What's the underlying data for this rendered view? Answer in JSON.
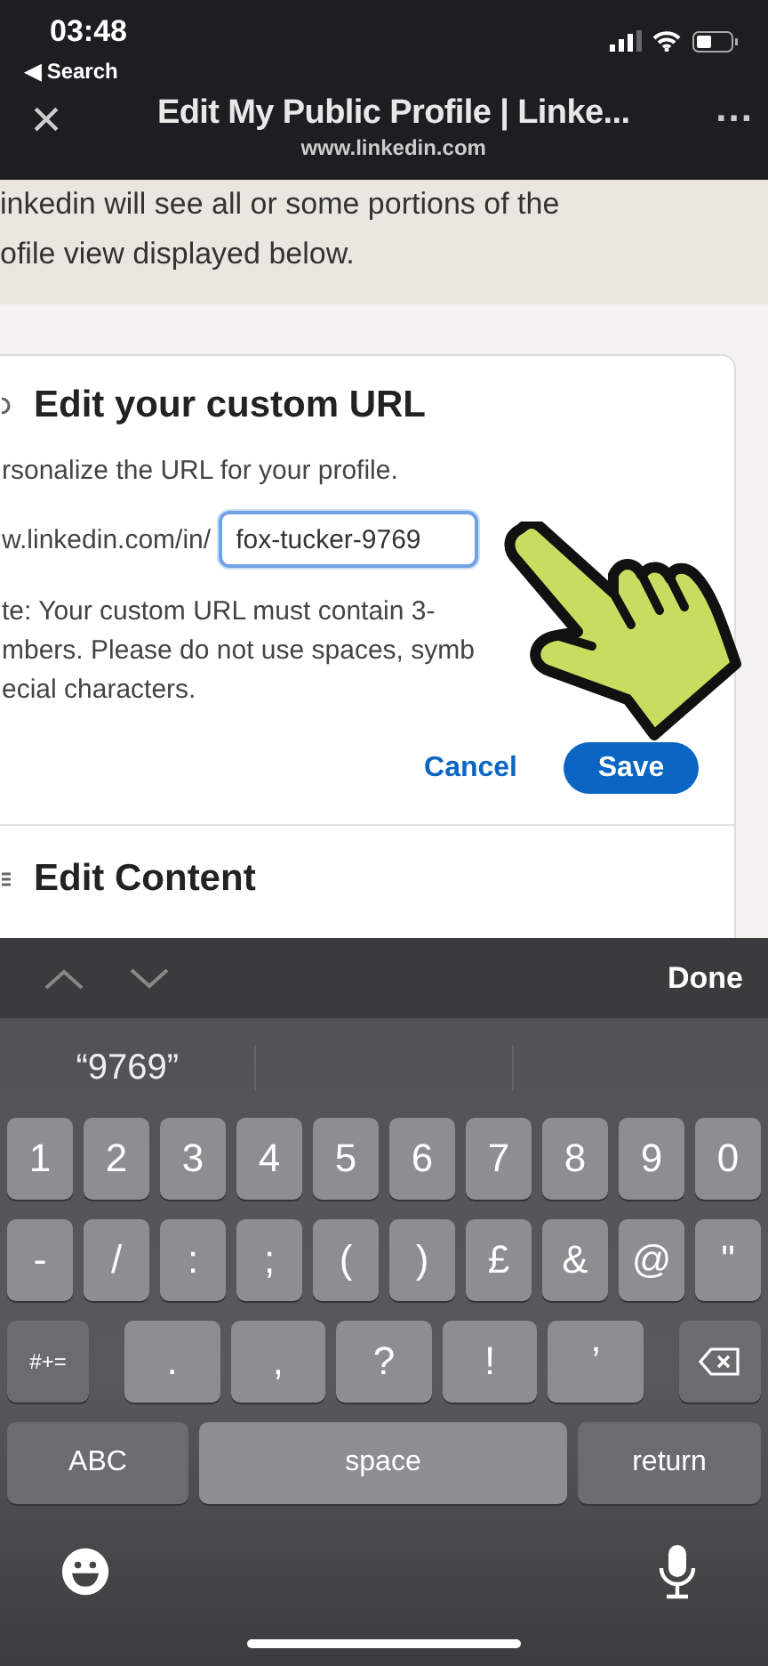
{
  "status_bar": {
    "time": "03:48",
    "back_label": "◀ Search"
  },
  "nav_bar": {
    "close": "×",
    "title": "Edit My Public Profile | Linke...",
    "subtitle": "www.linkedin.com",
    "more": "..."
  },
  "intro_lines": [
    "inkedin will see all or some portions of the",
    "ofile view displayed below."
  ],
  "card": {
    "title": "Edit your custom URL",
    "subtitle": "rsonalize the URL for your profile.",
    "url_prefix": "w.linkedin.com/in/",
    "url_field": {
      "value": "fox-tucker-9769",
      "focused": true
    },
    "note": [
      "te: Your custom URL must contain 3-",
      "mbers. Please do not use spaces, symb",
      "ecial characters."
    ],
    "cancel": "Cancel",
    "save": "Save",
    "next_section": "Edit Content"
  },
  "keyboard": {
    "done": "Done",
    "suggestions": [
      "“9769”"
    ],
    "number_row": [
      {
        "kind": "char",
        "label": "1"
      },
      {
        "kind": "char",
        "label": "2"
      },
      {
        "kind": "char",
        "label": "3"
      },
      {
        "kind": "char",
        "label": "4"
      },
      {
        "kind": "char",
        "label": "5"
      },
      {
        "kind": "char",
        "label": "6"
      },
      {
        "kind": "char",
        "label": "7"
      },
      {
        "kind": "char",
        "label": "8"
      },
      {
        "kind": "char",
        "label": "9"
      },
      {
        "kind": "char",
        "label": "0"
      }
    ],
    "symbol_row": [
      {
        "kind": "char",
        "label": "-"
      },
      {
        "kind": "char",
        "label": "/"
      },
      {
        "kind": "char",
        "label": ":"
      },
      {
        "kind": "char",
        "label": ";"
      },
      {
        "kind": "char",
        "label": "("
      },
      {
        "kind": "char",
        "label": ")"
      },
      {
        "kind": "char",
        "label": "£"
      },
      {
        "kind": "char",
        "label": "&"
      },
      {
        "kind": "char",
        "label": "@"
      },
      {
        "kind": "char",
        "label": "\""
      }
    ],
    "punctuation_row": [
      {
        "kind": "mod",
        "label": "#+="
      },
      {
        "kind": "wide",
        "label": "."
      },
      {
        "kind": "wide",
        "label": ","
      },
      {
        "kind": "wide",
        "label": "?"
      },
      {
        "kind": "wide",
        "label": "!"
      },
      {
        "kind": "wide",
        "label": "’"
      },
      {
        "kind": "delete"
      }
    ],
    "bottom_row": [
      {
        "kind": "abc",
        "label": "ABC"
      },
      {
        "kind": "space",
        "label": "space"
      },
      {
        "kind": "return",
        "label": "return"
      }
    ]
  }
}
